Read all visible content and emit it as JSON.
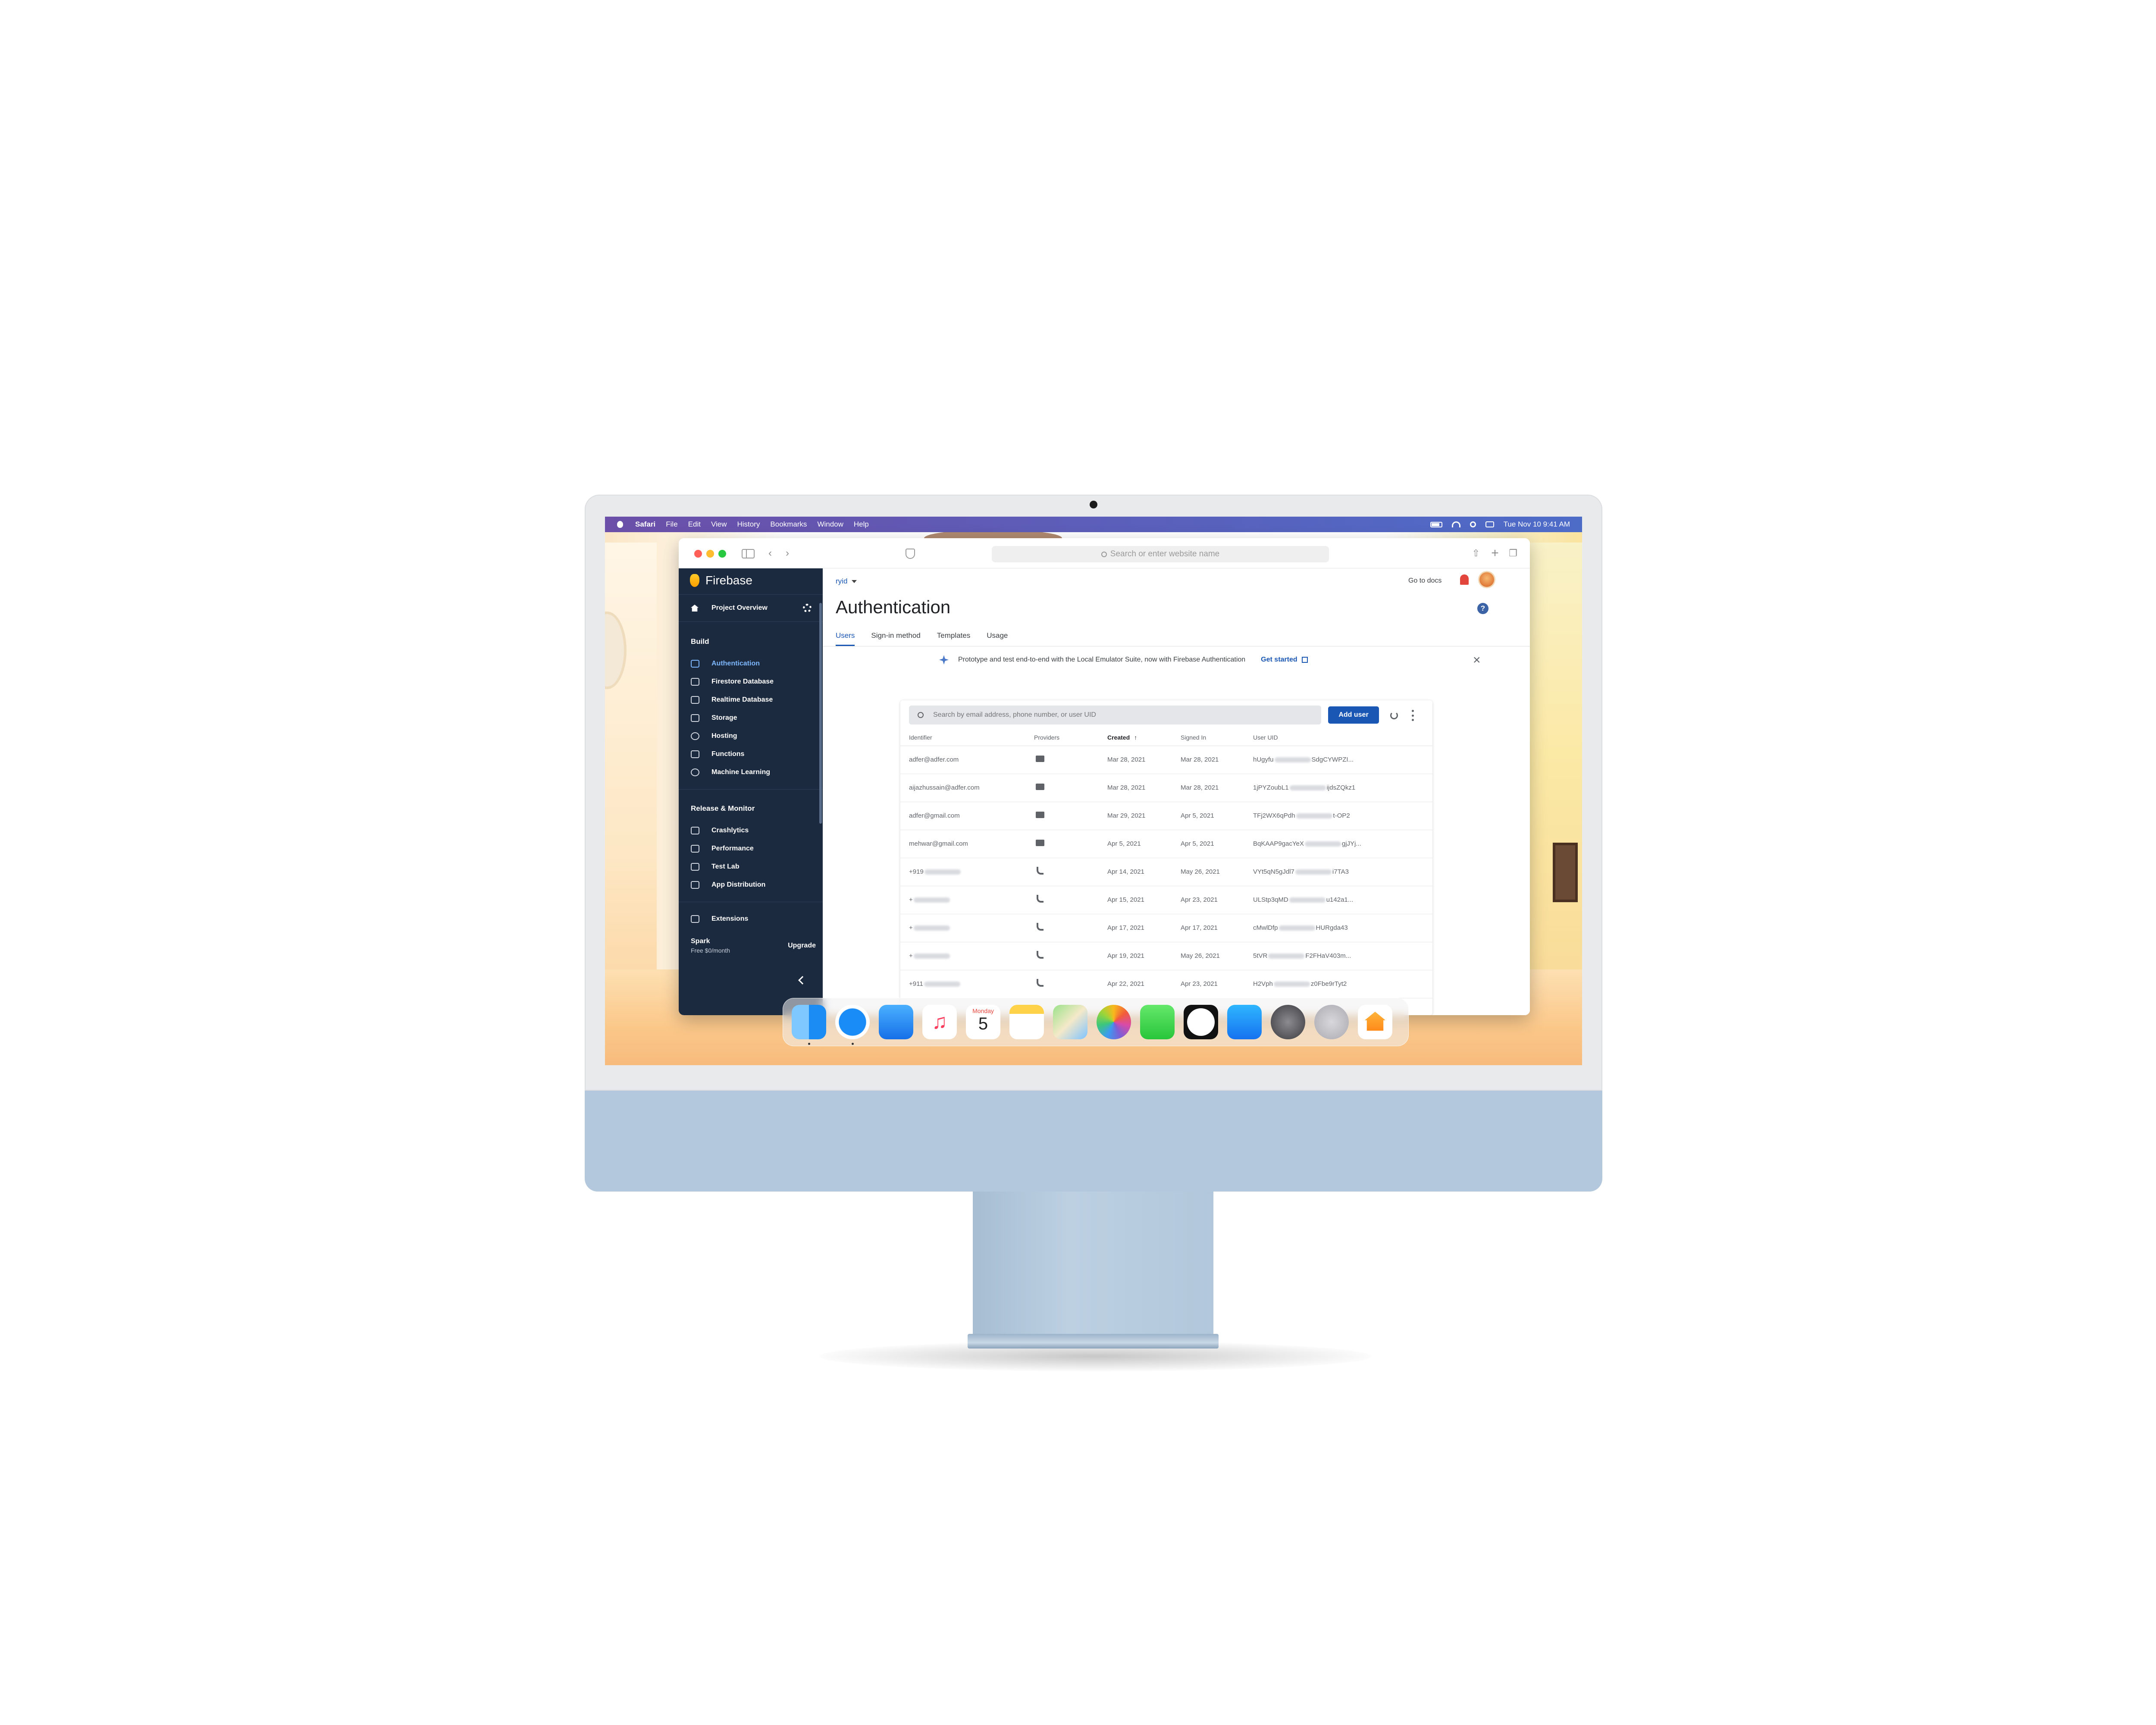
{
  "menubar": {
    "app": "Safari",
    "items": [
      "File",
      "Edit",
      "View",
      "History",
      "Bookmarks",
      "Window",
      "Help"
    ],
    "clock": "Tue Nov 10  9:41 AM"
  },
  "safari": {
    "address_placeholder": "Search or enter website name"
  },
  "sidebar": {
    "brand": "Firebase",
    "overview": "Project Overview",
    "build_title": "Build",
    "build_items": [
      {
        "label": "Authentication",
        "icon": "people-icon"
      },
      {
        "label": "Firestore Database",
        "icon": "firestore-icon"
      },
      {
        "label": "Realtime Database",
        "icon": "database-icon"
      },
      {
        "label": "Storage",
        "icon": "folder-icon"
      },
      {
        "label": "Hosting",
        "icon": "globe-icon"
      },
      {
        "label": "Functions",
        "icon": "functions-icon"
      },
      {
        "label": "Machine Learning",
        "icon": "robot-icon"
      }
    ],
    "release_title": "Release & Monitor",
    "release_items": [
      {
        "label": "Crashlytics",
        "icon": "crash-icon"
      },
      {
        "label": "Performance",
        "icon": "speedometer-icon"
      },
      {
        "label": "Test Lab",
        "icon": "checklist-icon"
      },
      {
        "label": "App Distribution",
        "icon": "distribution-icon"
      }
    ],
    "extensions": "Extensions",
    "plan_name": "Spark",
    "plan_price": "Free $0/month",
    "upgrade": "Upgrade"
  },
  "header": {
    "project": "ryid",
    "go_to_docs": "Go to docs",
    "help": "?"
  },
  "main": {
    "title": "Authentication",
    "tabs": [
      "Users",
      "Sign-in method",
      "Templates",
      "Usage"
    ],
    "banner_text": "Prototype and test end-to-end with the Local Emulator Suite, now with Firebase Authentication",
    "banner_link": "Get started",
    "search_placeholder": "Search by email address, phone number, or user UID",
    "add_user": "Add user",
    "columns": [
      "Identifier",
      "Providers",
      "Created",
      "Signed In",
      "User UID"
    ],
    "rows": [
      {
        "identifier": "adfer@adfer.com",
        "provider": "email",
        "created": "Mar 28, 2021",
        "signed_in": "Mar 28, 2021",
        "uid_start": "hUgyfu",
        "uid_end": "SdgCYWPZI..."
      },
      {
        "identifier": "aijazhussain@adfer.com",
        "provider": "email",
        "created": "Mar 28, 2021",
        "signed_in": "Mar 28, 2021",
        "uid_start": "1jPYZoubL1",
        "uid_end": "ijdsZQkz1"
      },
      {
        "identifier": "adfer@gmail.com",
        "provider": "email",
        "created": "Mar 29, 2021",
        "signed_in": "Apr 5, 2021",
        "uid_start": "TFj2WX6qPdh",
        "uid_end": "t-OP2"
      },
      {
        "identifier": "mehwar@gmail.com",
        "provider": "email",
        "created": "Apr 5, 2021",
        "signed_in": "Apr 5, 2021",
        "uid_start": "BqKAAP9gacYeX",
        "uid_end": "gjJYj..."
      },
      {
        "identifier": "+919",
        "provider": "phone",
        "created": "Apr 14, 2021",
        "signed_in": "May 26, 2021",
        "uid_start": "VYt5qN5gJdl7",
        "uid_end": "i7TA3"
      },
      {
        "identifier": "+",
        "provider": "phone",
        "created": "Apr 15, 2021",
        "signed_in": "Apr 23, 2021",
        "uid_start": "ULStp3qMD",
        "uid_end": "u142a1..."
      },
      {
        "identifier": "+",
        "provider": "phone",
        "created": "Apr 17, 2021",
        "signed_in": "Apr 17, 2021",
        "uid_start": "cMwlDfp",
        "uid_end": "HURgda43"
      },
      {
        "identifier": "+",
        "provider": "phone",
        "created": "Apr 19, 2021",
        "signed_in": "May 26, 2021",
        "uid_start": "5tVR",
        "uid_end": "F2FHaV403m..."
      },
      {
        "identifier": "+911",
        "provider": "phone",
        "created": "Apr 22, 2021",
        "signed_in": "Apr 23, 2021",
        "uid_start": "H2Vph",
        "uid_end": "z0Fbe9rTyt2"
      }
    ]
  },
  "dock": {
    "apps": [
      "finder-icon",
      "safari-icon",
      "mail-icon",
      "music-icon",
      "calendar-icon",
      "notes-icon",
      "maps-icon",
      "photos-icon",
      "messages-icon",
      "clock-icon",
      "app-store-icon",
      "system-preferences-icon",
      "launchpad-icon",
      "home-icon"
    ],
    "calendar_month": "Monday",
    "calendar_day": "5"
  },
  "colors": {
    "firebase_sidebar": "#1c2a3f",
    "accent_blue": "#1a56b4",
    "active_nav": "#7db8ff",
    "imac_chin": "#b3c8dc"
  }
}
